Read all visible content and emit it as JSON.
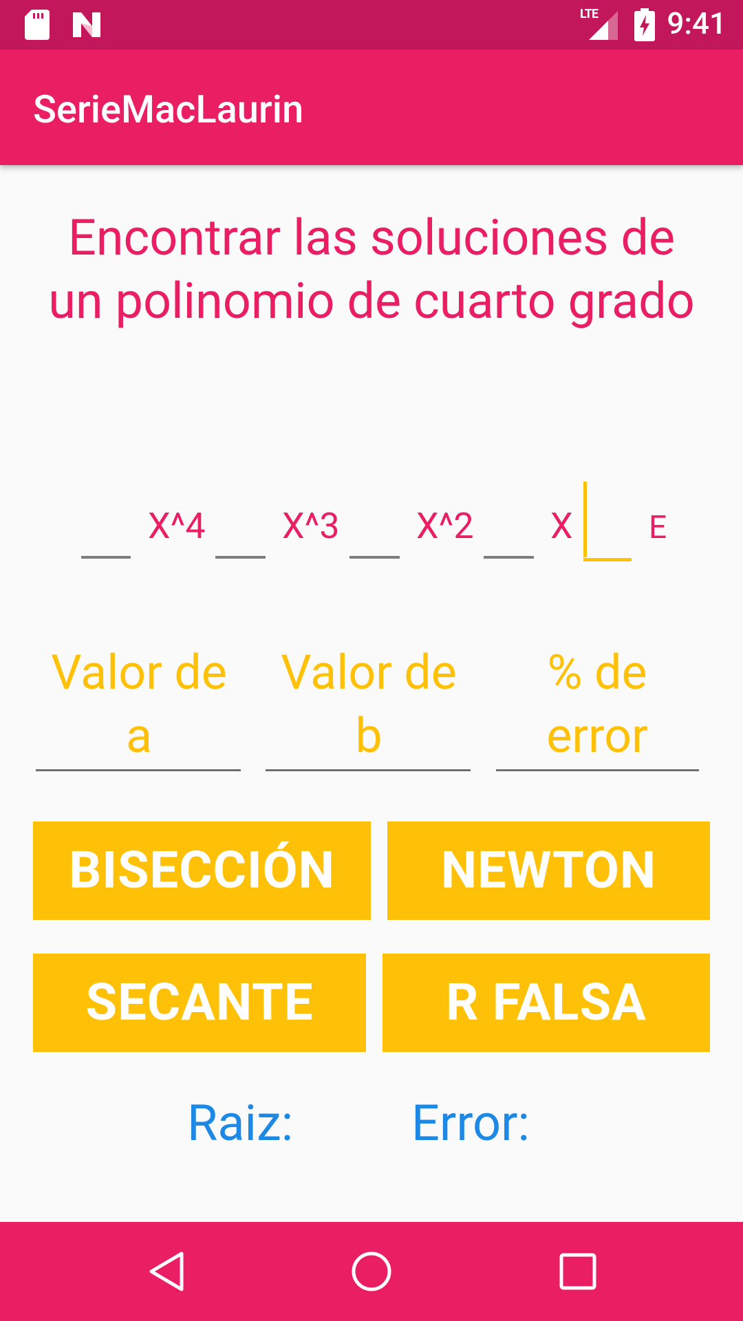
{
  "status_bar": {
    "time": "9:41",
    "network": "LTE"
  },
  "app_bar": {
    "title": "SerieMacLaurin"
  },
  "heading": "Encontrar las soluciones de un polinomio de cuarto grado",
  "polynomial": {
    "terms": [
      "X^4",
      "X^3",
      "X^2",
      "X",
      "E"
    ],
    "coefficient_values": [
      "",
      "",
      "",
      "",
      ""
    ]
  },
  "params": {
    "a_hint": "Valor de a",
    "b_hint": "Valor de b",
    "error_hint": "% de error"
  },
  "buttons": {
    "biseccion": "BISECCIÓN",
    "newton": "NEWTON",
    "secante": "SECANTE",
    "rfalsa": "R FALSA"
  },
  "results": {
    "root_label": "Raiz:",
    "error_label": "Error:"
  },
  "colors": {
    "primary": "#e91e63",
    "primary_dark": "#c2185b",
    "accent": "#ffc107",
    "result_text": "#1e88e5"
  },
  "icons": {
    "status_left": [
      "sd-card-icon",
      "n-logo-icon"
    ],
    "status_right": [
      "lte-signal-icon",
      "battery-charging-icon"
    ],
    "nav": [
      "back-icon",
      "home-icon",
      "recents-icon"
    ]
  }
}
